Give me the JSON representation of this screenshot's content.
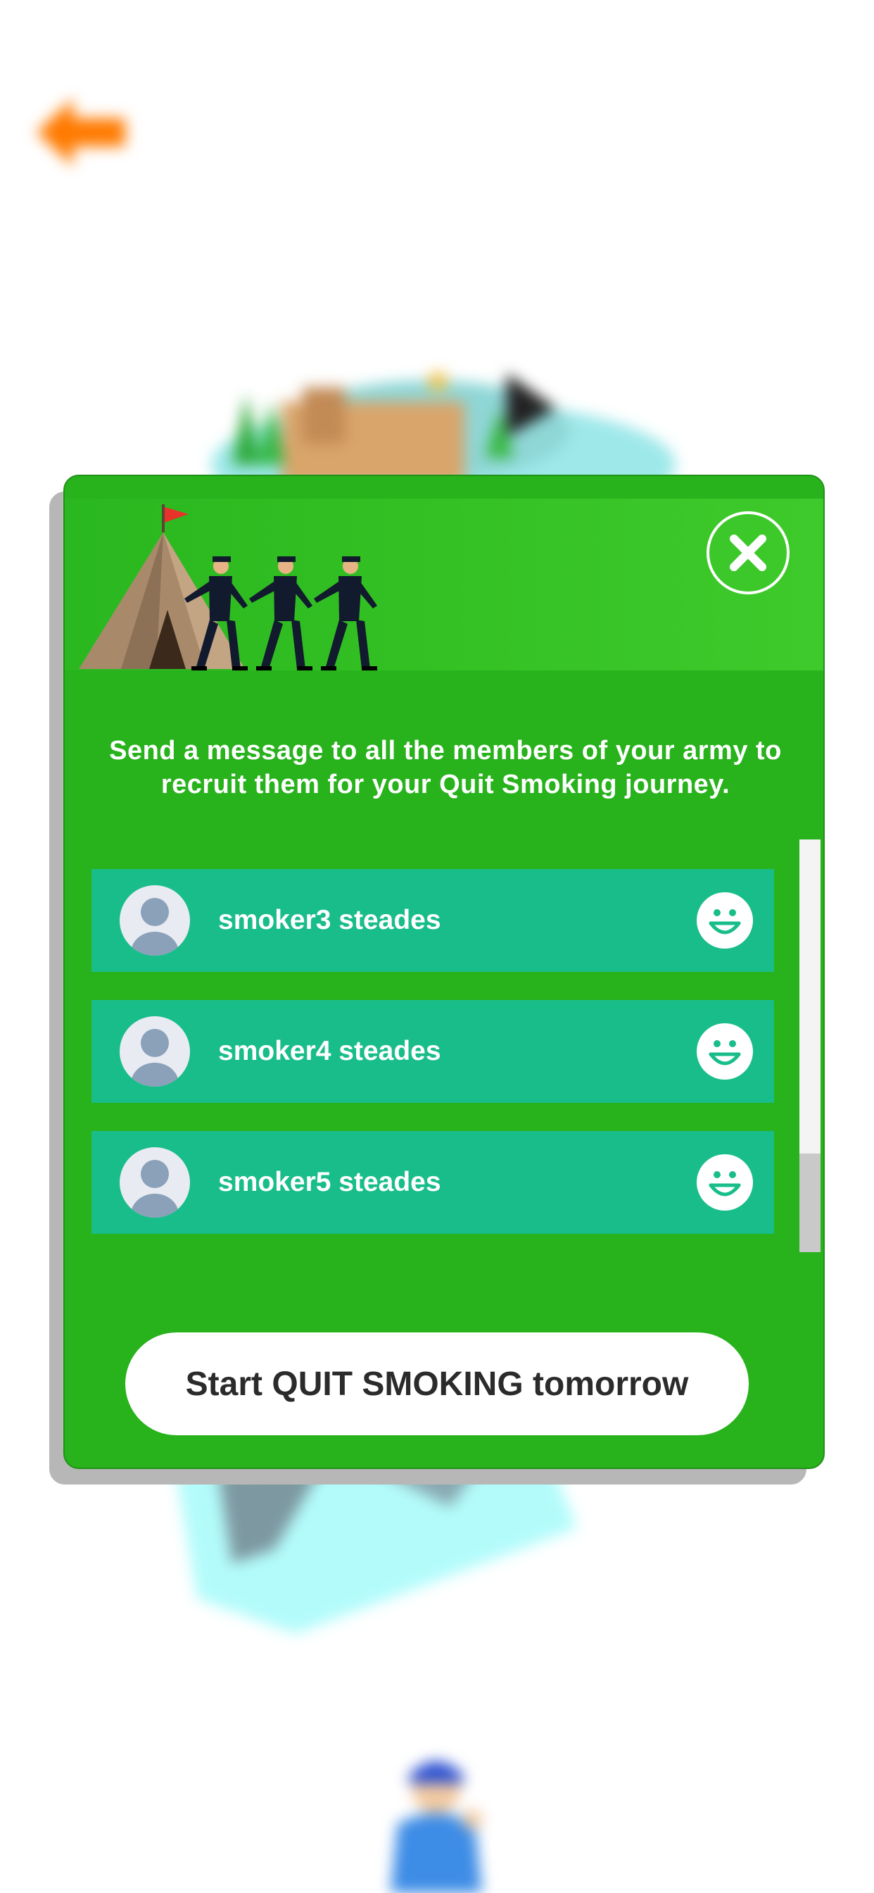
{
  "colors": {
    "modal_green": "#28b21c",
    "row_teal": "#19bd8a",
    "back_arrow_orange": "#ff7a00",
    "button_text": "#2b2b2b"
  },
  "icons": {
    "back": "back-arrow-icon",
    "close": "close-icon",
    "avatar": "user-avatar-icon",
    "status": "smiley-icon"
  },
  "modal": {
    "message": "Send a message to all the members of your army to recruit them for your Quit Smoking journey.",
    "members": [
      {
        "name": "smoker3 steades"
      },
      {
        "name": "smoker4 steades"
      },
      {
        "name": "smoker5 steades"
      }
    ],
    "start_button_label": "Start QUIT SMOKING tomorrow"
  }
}
